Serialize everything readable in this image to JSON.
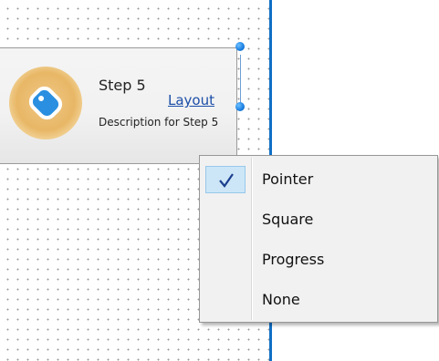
{
  "step": {
    "title": "Step 5",
    "description": "Description for Step 5",
    "link_label": "Layout",
    "icon": "tag-icon"
  },
  "menu": {
    "items": [
      {
        "label": "Pointer",
        "checked": true
      },
      {
        "label": "Square",
        "checked": false
      },
      {
        "label": "Progress",
        "checked": false
      },
      {
        "label": "None",
        "checked": false
      }
    ],
    "check_icon": "checkmark-icon"
  },
  "colors": {
    "canvas_edge": "#0f6fc6",
    "link": "#1c4ea8",
    "menu_background": "#f1f1f1",
    "check_highlight": "#cde6f7",
    "icon_circle": "#e8b766",
    "handle": "#1a7ee0"
  }
}
